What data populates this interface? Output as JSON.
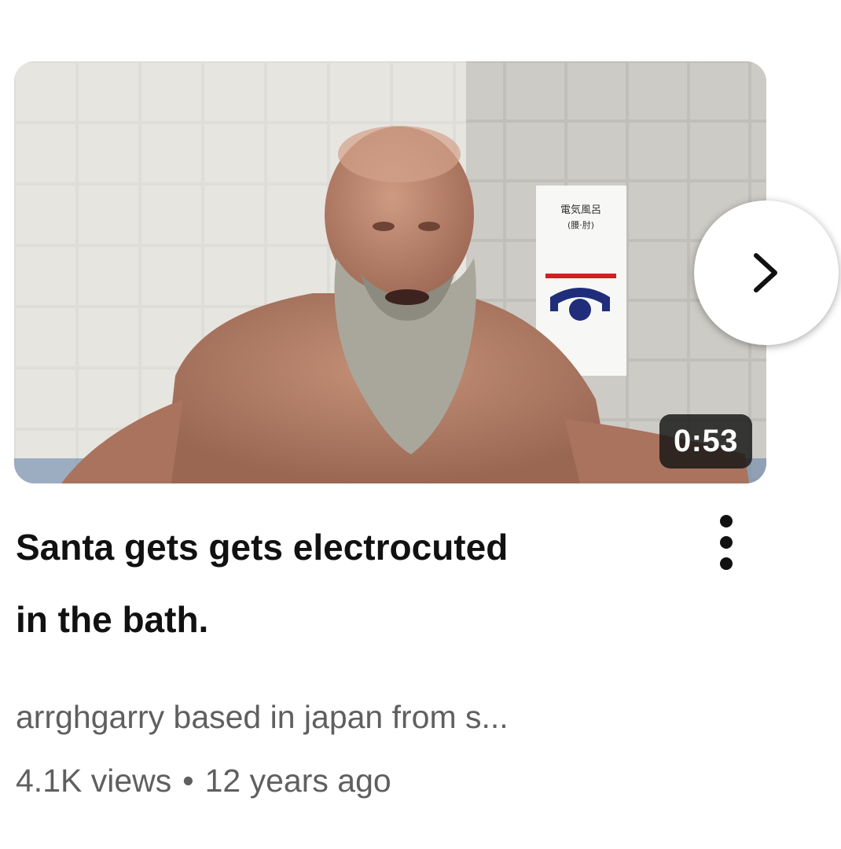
{
  "video": {
    "duration": "0:53",
    "title_lines": [
      "Santa gets gets electrocuted",
      "in the bath."
    ],
    "channel": "arrghgarry based in japan from s...",
    "views": "4.1K views",
    "separator": "•",
    "age": "12 years ago"
  },
  "icons": {
    "next": "chevron-right-icon",
    "more": "more-vert-icon"
  },
  "colors": {
    "title": "#111111",
    "secondary_text": "#5f5f5f",
    "duration_bg": "#141414",
    "duration_text": "#ffffff"
  }
}
